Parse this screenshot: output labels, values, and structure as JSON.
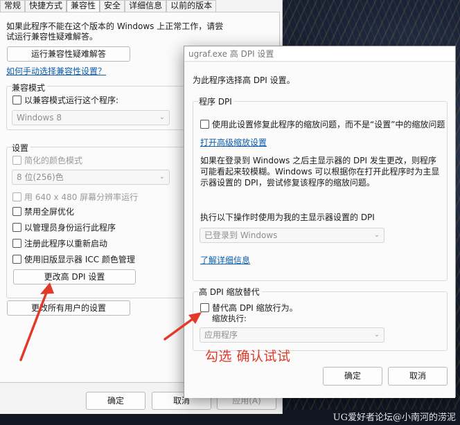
{
  "tabs": [
    "常规",
    "快捷方式",
    "兼容性",
    "安全",
    "详细信息",
    "以前的版本"
  ],
  "active_tab": "兼容性",
  "props": {
    "intro": "如果此程序不能在这个版本的 Windows 上正常工作，请尝试运行兼容性疑难解答。",
    "run_troubleshooter": "运行兼容性疑难解答",
    "manual_link": "如何手动选择兼容性设置？",
    "compat_mode": {
      "title": "兼容模式",
      "checkbox": "以兼容模式运行这个程序:",
      "select_value": "Windows 8"
    },
    "settings": {
      "title": "设置",
      "reduced_color": "简化的颜色模式",
      "color_select": "8 位(256)色",
      "res_640": "用 640 x 480 屏幕分辨率运行",
      "disable_fullscreen": "禁用全屏优化",
      "run_admin": "以管理员身份运行此程序",
      "register_restart": "注册此程序以重新启动",
      "legacy_icc": "使用旧版显示器 ICC 颜色管理",
      "change_dpi": "更改高 DPI 设置"
    },
    "all_users": "更改所有用户的设置",
    "ok": "确定",
    "cancel": "取消",
    "apply": "应用(A)"
  },
  "dialog": {
    "title": "ugraf.exe 高 DPI 设置",
    "prompt": "为此程序选择高 DPI 设置。",
    "program_dpi": {
      "title": "程序 DPI",
      "checkbox": "使用此设置修复此程序的缩放问题，而不是“设置”中的缩放问题",
      "advanced_link": "打开高级缩放设置",
      "desc": "如果在登录到 Windows 之后主显示器的 DPI 发生更改，则程序可能看起来较模糊。Windows 可以根据你在打开此程序时为主显示器设置的 DPI，尝试修复该程序的缩放问题。",
      "use_dpi_label": "执行以下操作时使用为我的主显示器设置的 DPI",
      "select_value": "已登录到 Windows",
      "learn_more": "了解详细信息"
    },
    "override": {
      "title": "高 DPI 缩放替代",
      "checkbox": "替代高 DPI 缩放行为。",
      "performed_by": "缩放执行:",
      "select_value": "应用程序"
    },
    "ok": "确定",
    "cancel": "取消"
  },
  "annotation": "勾选  确认试试",
  "watermark": "UG爱好者论坛@小南河的涝泥",
  "colors": {
    "annotation": "#e23a2a",
    "link": "#0b5cad"
  }
}
